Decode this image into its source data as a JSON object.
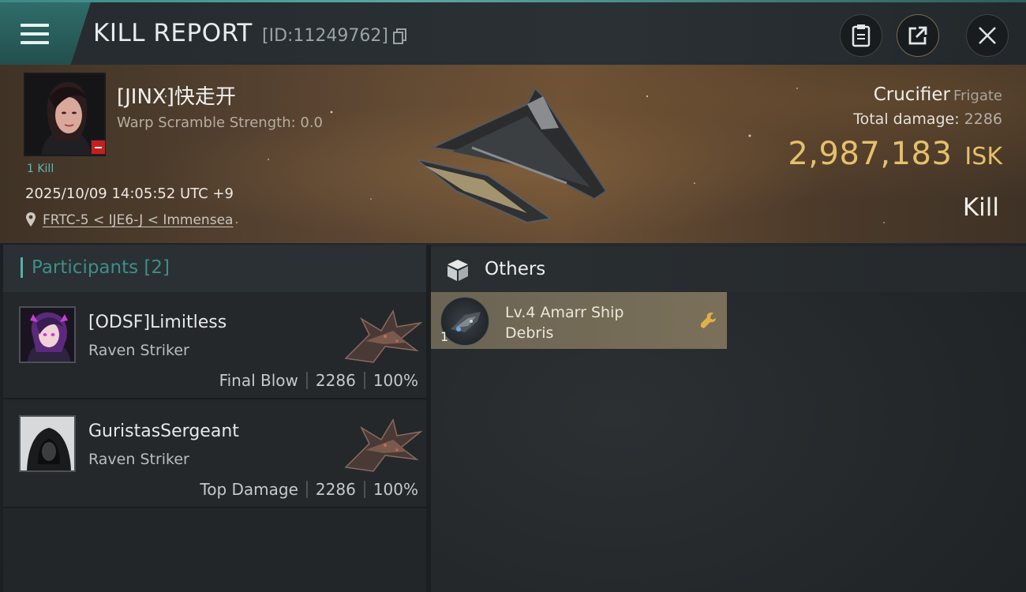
{
  "header": {
    "title": "KILL REPORT",
    "report_id": "[ID:11249762]",
    "icons": {
      "menu": "menu-icon",
      "copy": "copy-icon",
      "report": "clipboard-icon",
      "share": "share-icon",
      "close": "close-icon"
    }
  },
  "victim": {
    "name": "[JINX]快走开",
    "warp_scramble": "Warp Scramble Strength: 0.0",
    "kill_count": "1 Kill",
    "datetime": "2025/10/09 14:05:52 UTC +9",
    "location": "FRTC-5 < IJE6-J < Immensea",
    "ship_name": "Crucifier",
    "ship_class": "Frigate",
    "total_damage_label": "Total damage:",
    "total_damage": "2286",
    "isk_value": "2,987,183",
    "isk_unit": "ISK",
    "result": "Kill"
  },
  "participants": {
    "title": "Participants [2]",
    "items": [
      {
        "name": "[ODSF]Limitless",
        "ship": "Raven Striker",
        "role": "Final Blow",
        "damage": "2286",
        "percent": "100%"
      },
      {
        "name": "GuristasSergeant",
        "ship": "Raven Striker",
        "role": "Top Damage",
        "damage": "2286",
        "percent": "100%"
      }
    ]
  },
  "others": {
    "title": "Others",
    "items": [
      {
        "quantity": "1",
        "name": "Lv.4 Amarr Ship Debris"
      }
    ]
  },
  "colors": {
    "accent_teal": "#4fb3a8",
    "isk_gold": "#e5c06b",
    "item_card": "#756c57",
    "corp_badge": "#c42020"
  }
}
